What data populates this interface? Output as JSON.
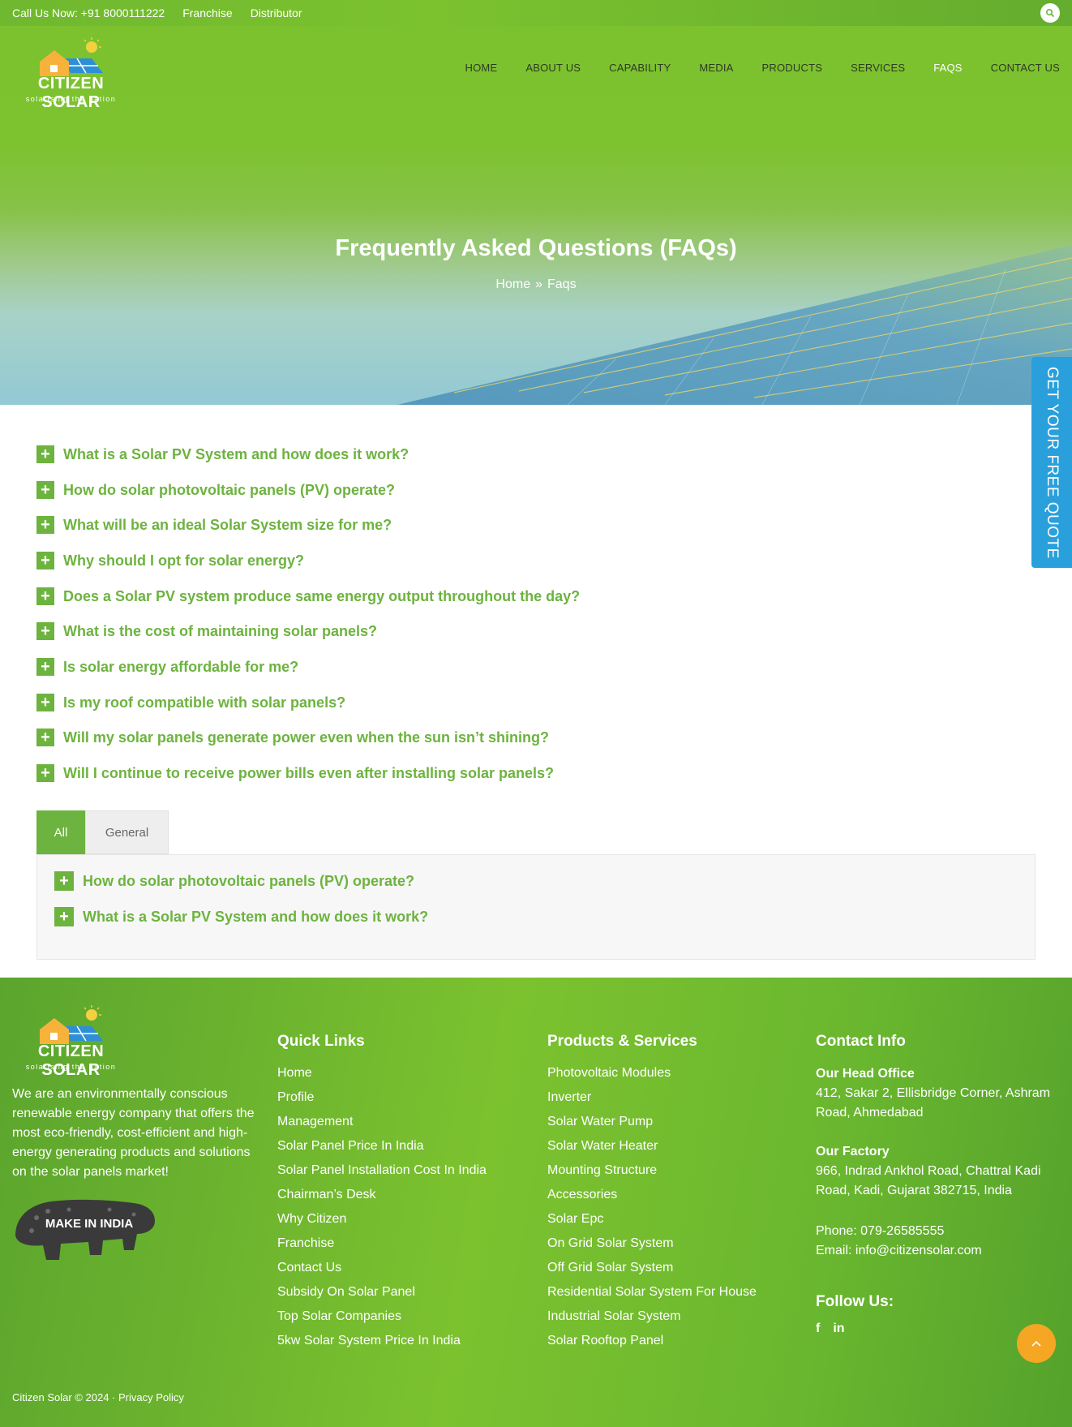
{
  "topbar": {
    "call": "Call Us Now: +91 8000111222",
    "links": [
      "Franchise",
      "Distributor"
    ]
  },
  "brand": {
    "name": "CITIZEN SOLAR",
    "tagline": "solarising the nation",
    "colors": {
      "green": "#6db33f",
      "blue": "#29a0dc",
      "orange": "#f5a623",
      "house": "#f6b23b",
      "panel": "#2f8fd6",
      "sun": "#f4d03f"
    }
  },
  "nav": [
    "HOME",
    "ABOUT US",
    "CAPABILITY",
    "MEDIA",
    "PRODUCTS",
    "SERVICES",
    "FAQS",
    "CONTACT US"
  ],
  "hero": {
    "title": "Frequently Asked Questions (FAQs)",
    "breadcrumb": {
      "home": "Home",
      "separator": "»",
      "current": "Faqs"
    }
  },
  "quote_tab": "GET YOUR FREE QUOTE",
  "faqs": [
    "What is a Solar PV System and how does it work?",
    "How do solar photovoltaic panels (PV) operate?",
    "What will be an ideal Solar System size for me?",
    "Why should I opt for solar energy?",
    "Does a Solar PV system produce same energy output throughout the day?",
    "What is the cost of maintaining solar panels?",
    "Is solar energy affordable for me?",
    "Is my roof compatible with solar panels?",
    "Will my solar panels generate power even when the sun isn’t shining?",
    "Will I continue to receive power bills even after installing solar panels?"
  ],
  "tabs": [
    "All",
    "General"
  ],
  "tab_faqs": [
    "How do solar photovoltaic panels (PV) operate?",
    "What is a Solar PV System and how does it work?"
  ],
  "footer": {
    "about": "We are an environmentally conscious renewable energy company that offers the most eco-friendly, cost-efficient and high-energy generating products and solutions on the solar panels market!",
    "badge_text": "MAKE IN INDIA",
    "quick_links": {
      "title": "Quick Links",
      "items": [
        "Home",
        "Profile",
        "Management",
        "Solar Panel Price In India",
        "Solar Panel Installation Cost In India",
        "Chairman’s Desk",
        "Why Citizen",
        "Franchise",
        "Contact Us",
        "Subsidy On Solar Panel",
        "Top Solar Companies",
        "5kw Solar System Price In India"
      ]
    },
    "products": {
      "title": "Products & Services",
      "items": [
        "Photovoltaic Modules",
        "Inverter",
        "Solar Water Pump",
        "Solar Water Heater",
        "Mounting Structure",
        "Accessories",
        "Solar Epc",
        "On Grid Solar System",
        "Off Grid Solar System",
        "Residential Solar System For House",
        "Industrial Solar System",
        "Solar Rooftop Panel"
      ]
    },
    "contact": {
      "title": "Contact Info",
      "head_office_label": "Our Head Office",
      "head_office": "412, Sakar 2, Ellisbridge Corner, Ashram Road, Ahmedabad",
      "factory_label": "Our Factory",
      "factory": "966, Indrad Ankhol Road, Chattral Kadi Road, Kadi, Gujarat 382715, India",
      "phone": "Phone: 079-26585555",
      "email": "Email: info@citizensolar.com",
      "follow": "Follow Us:",
      "social": [
        {
          "icon": "facebook-icon",
          "glyph": "f"
        },
        {
          "icon": "linkedin-icon",
          "glyph": "in"
        }
      ]
    },
    "copyright": "Citizen Solar © 2024 ·",
    "privacy": "Privacy Policy"
  }
}
